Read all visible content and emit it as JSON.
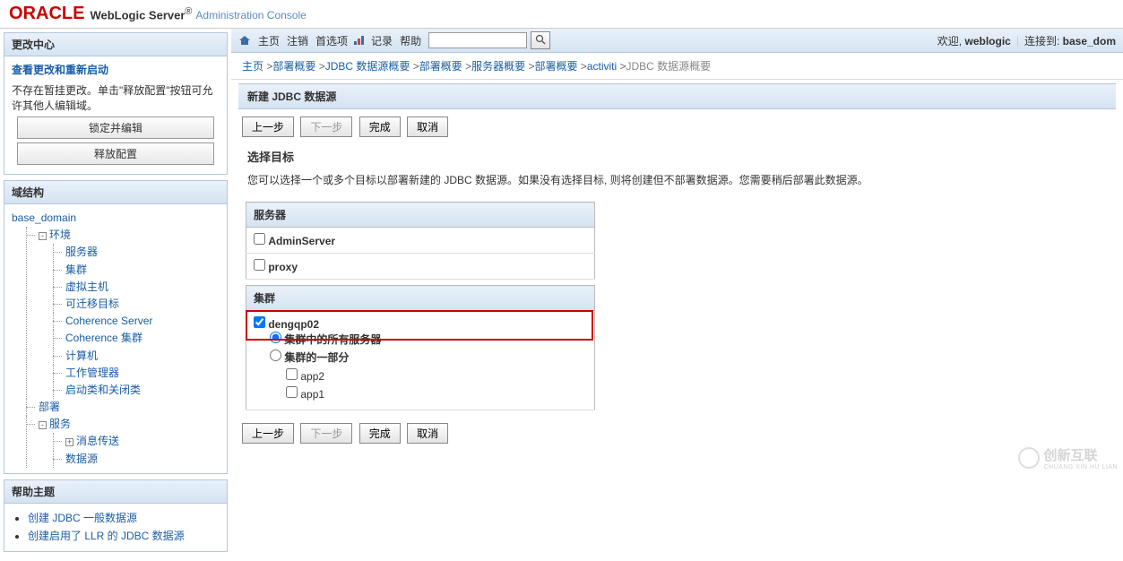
{
  "header": {
    "logo": "ORACLE",
    "product": "WebLogic Server",
    "reg": "®",
    "subtitle": "Administration Console"
  },
  "toolbar": {
    "home": "主页",
    "logout": "注销",
    "prefs": "首选项",
    "record": "记录",
    "help": "帮助",
    "welcome_prefix": "欢迎,",
    "welcome_user": "weblogic",
    "connected_prefix": "连接到:",
    "connected_domain": "base_dom"
  },
  "breadcrumb": {
    "items": [
      "主页",
      "部署概要",
      "JDBC 数据源概要",
      "部署概要",
      "服务器概要",
      "部署概要",
      "activiti",
      "JDBC 数据源概要"
    ]
  },
  "change_center": {
    "title": "更改中心",
    "link": "查看更改和重新启动",
    "msg": "不存在暂挂更改。单击\"释放配置\"按钮可允许其他人编辑域。",
    "btn_lock": "锁定并编辑",
    "btn_release": "释放配置"
  },
  "domain_tree": {
    "title": "域结构",
    "root": "base_domain",
    "env": "环境",
    "env_children": [
      "服务器",
      "集群",
      "虚拟主机",
      "可迁移目标",
      "Coherence Server",
      "Coherence 集群",
      "计算机",
      "工作管理器",
      "启动类和关闭类"
    ],
    "deploy": "部署",
    "services": "服务",
    "svc_children": [
      "消息传送",
      "数据源"
    ]
  },
  "help_panel": {
    "title": "帮助主题",
    "items": [
      "创建 JDBC 一般数据源",
      "创建启用了 LLR 的 JDBC 数据源"
    ]
  },
  "main_section": {
    "title": "新建 JDBC 数据源",
    "btn_prev": "上一步",
    "btn_next": "下一步",
    "btn_finish": "完成",
    "btn_cancel": "取消",
    "heading": "选择目标",
    "desc": "您可以选择一个或多个目标以部署新建的 JDBC 数据源。如果没有选择目标, 则将创建但不部署数据源。您需要稍后部署此数据源。",
    "servers_header": "服务器",
    "servers": [
      "AdminServer",
      "proxy"
    ],
    "clusters_header": "集群",
    "cluster_name": "dengqp02",
    "opt_all": "集群中的所有服务器",
    "opt_part": "集群的一部分",
    "part_items": [
      "app2",
      "app1"
    ]
  },
  "footer": {
    "brand": "创新互联",
    "brand_en": "CHUANG XIN HU LIAN"
  }
}
